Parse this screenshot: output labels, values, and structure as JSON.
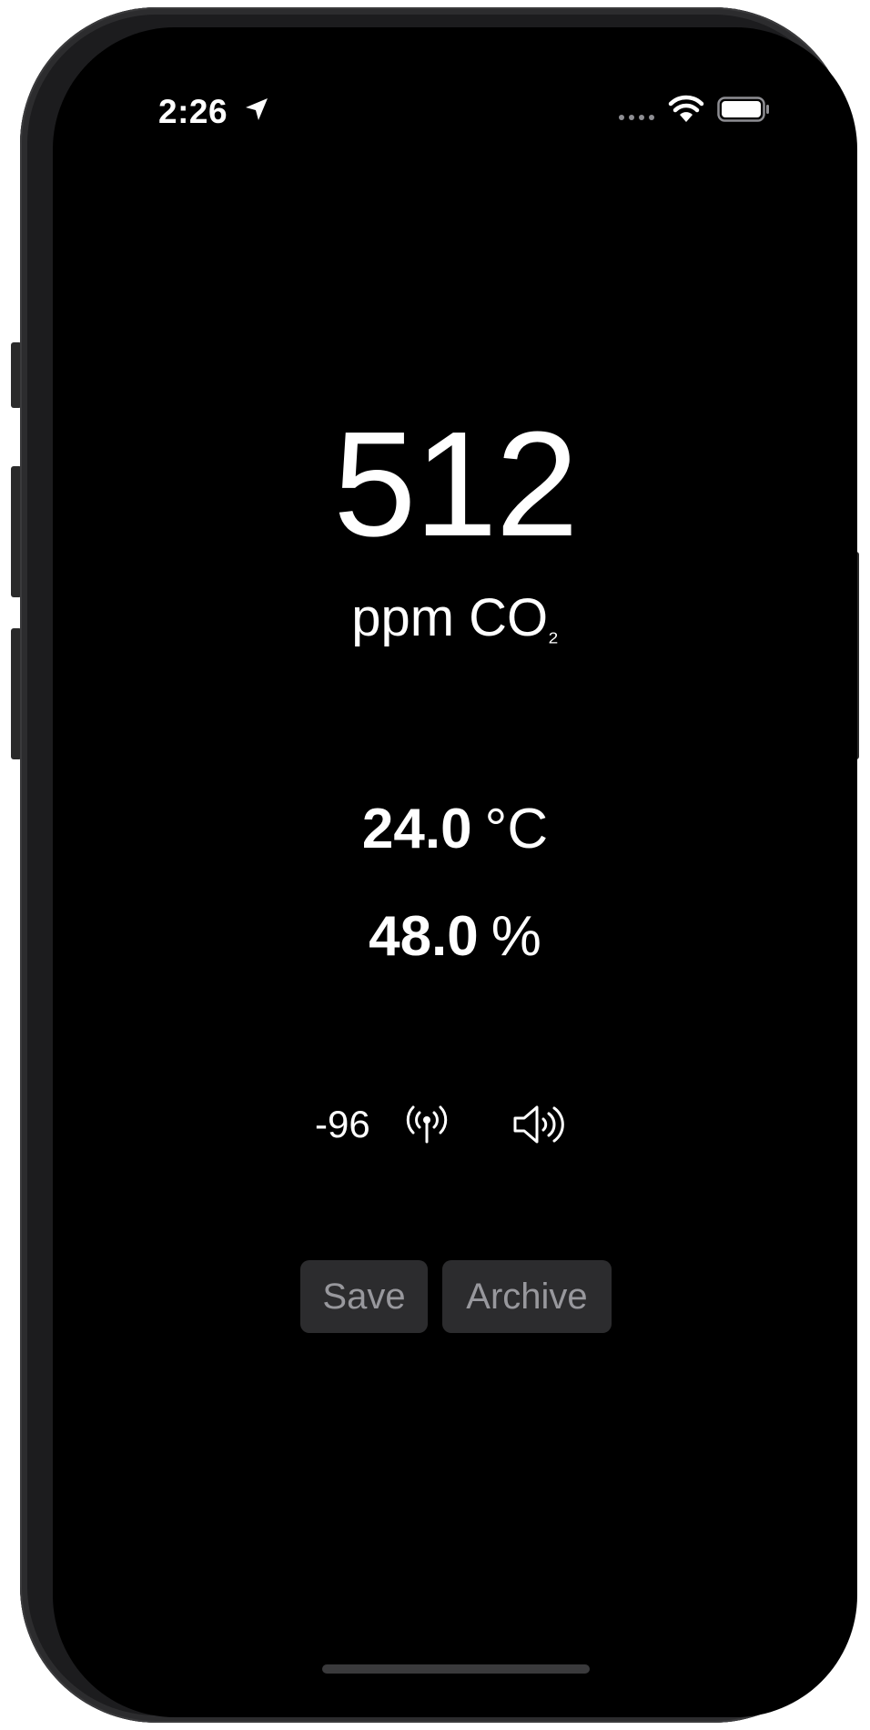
{
  "status_bar": {
    "time": "2:26",
    "icons": [
      "location-arrow-icon",
      "cellular-dots-icon",
      "wifi-icon",
      "battery-icon"
    ]
  },
  "co2": {
    "value": "512",
    "unit_prefix": "ppm CO",
    "unit_subscript": "₂"
  },
  "temperature": {
    "value": "24.0",
    "unit": "°C"
  },
  "humidity": {
    "value": "48.0",
    "unit": "%"
  },
  "signal": {
    "rssi": "-96",
    "antenna_icon": "antenna-icon",
    "speaker_icon": "speaker-icon"
  },
  "buttons": {
    "save_label": "Save",
    "archive_label": "Archive"
  },
  "colors": {
    "background": "#000000",
    "text": "#ffffff",
    "button_background": "#2c2c2e",
    "button_text": "#98989d"
  }
}
